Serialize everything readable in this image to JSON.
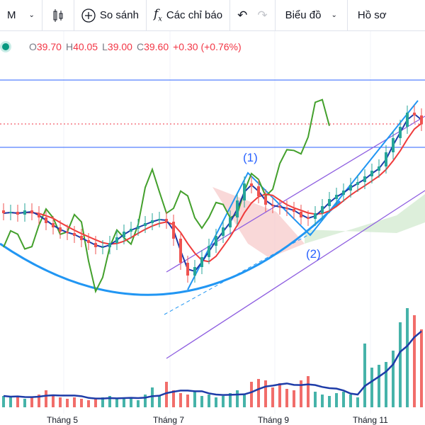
{
  "toolbar": {
    "interval": "M",
    "compare": "So sánh",
    "indicators": "Các chỉ báo",
    "chart_type": "Biểu đồ",
    "profile": "Hồ sơ"
  },
  "legend": {
    "o_label": "O",
    "o": "39.70",
    "h_label": "H",
    "h": "40.05",
    "l_label": "L",
    "l": "39.00",
    "c_label": "C",
    "c": "39.60",
    "change": "+0.30 (+0.76%)"
  },
  "annotations": {
    "wave1": "(1)",
    "wave2": "(2)"
  },
  "colors": {
    "up": "#26a69a",
    "down": "#ef5350",
    "accent": "#2962ff"
  },
  "chart_data": {
    "type": "candlestick",
    "x_ticks": [
      "Tháng 5",
      "Tháng 7",
      "Tháng 9",
      "Tháng 11"
    ],
    "close": [
      33.3,
      33.4,
      33.2,
      33.5,
      33.3,
      33.0,
      32.6,
      32.3,
      32.0,
      31.9,
      31.7,
      31.4,
      31.2,
      30.9,
      30.9,
      31.2,
      31.6,
      32.0,
      32.2,
      32.4,
      32.6,
      32.8,
      32.9,
      32.7,
      31.5,
      29.8,
      28.9,
      29.5,
      30.2,
      31.0,
      31.7,
      32.3,
      33.0,
      34.2,
      35.4,
      35.2,
      34.5,
      33.9,
      33.8,
      33.7,
      33.6,
      33.4,
      33.0,
      32.9,
      33.3,
      33.8,
      34.3,
      34.6,
      34.9,
      35.3,
      35.5,
      35.9,
      36.3,
      36.6,
      37.6,
      38.6,
      39.4,
      40.4,
      40.2,
      39.6
    ],
    "volume": [
      8,
      7,
      8,
      6,
      7,
      9,
      12,
      9,
      7,
      6,
      7,
      6,
      5,
      6,
      7,
      8,
      6,
      7,
      6,
      5,
      9,
      14,
      8,
      18,
      12,
      10,
      9,
      11,
      8,
      9,
      7,
      8,
      10,
      12,
      9,
      18,
      20,
      19,
      14,
      17,
      13,
      12,
      19,
      22,
      11,
      9,
      8,
      10,
      11,
      9,
      7,
      45,
      28,
      30,
      32,
      40,
      60,
      70,
      65,
      55
    ]
  }
}
